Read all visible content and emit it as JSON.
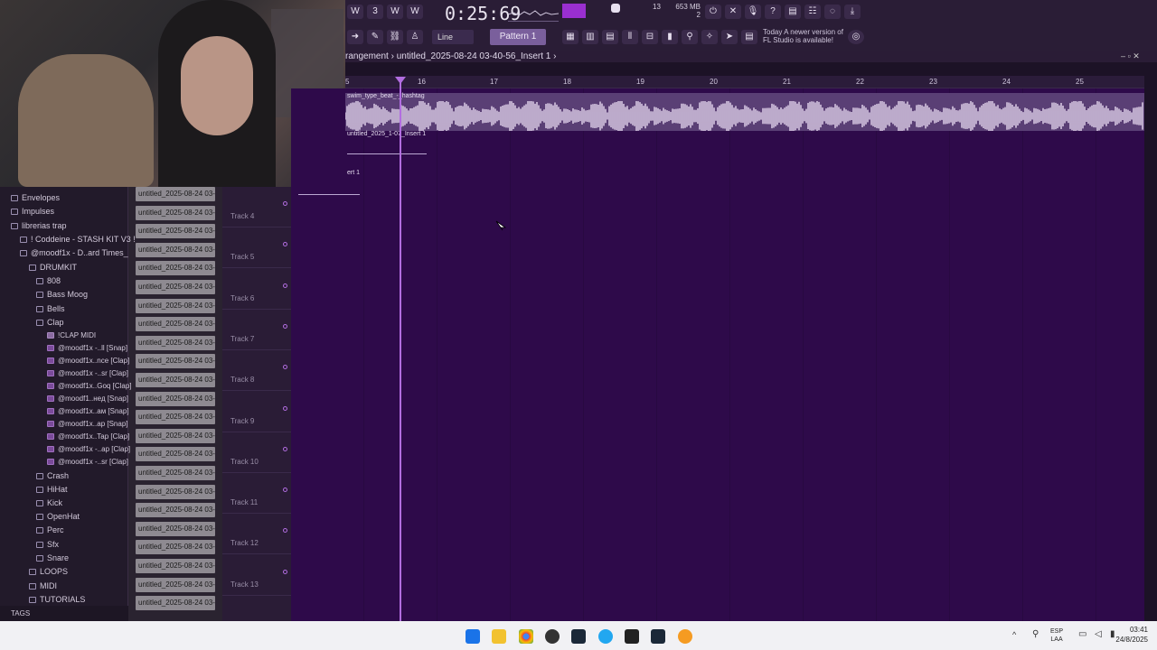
{
  "toolbar": {
    "time": "0:25:69",
    "cpu_count": "13",
    "memory": "653 MB",
    "voices": "2",
    "snap": "Line",
    "pattern": "Pattern 1",
    "news": "Today A newer version of FL Studio is available!"
  },
  "playlist": {
    "title": "rangement › untitled_2025-08-24 03-40-56_Insert 1 ›",
    "ruler": [
      "5",
      "16",
      "17",
      "18",
      "19",
      "20",
      "21",
      "22",
      "23",
      "24",
      "25"
    ],
    "audio_clip_label": "swim_type_beat_-_hashtag",
    "clip2_label": "untitled_2025_1-07_Insert 1",
    "clip3_label": "ert 1",
    "tracks": [
      "Track 4",
      "Track 5",
      "Track 6",
      "Track 7",
      "Track 8",
      "Track 9",
      "Track 10",
      "Track 11",
      "Track 12",
      "Track 13"
    ]
  },
  "channels": [
    "untitled_2025-08-24 03-...",
    "untitled_2025-08-24 03-...",
    "untitled_2025-08-24 03-...",
    "untitled_2025-08-24 03-...",
    "untitled_2025-08-24 03-...",
    "untitled_2025-08-24 03-...",
    "untitled_2025-08-24 03-...",
    "untitled_2025-08-24 03-...",
    "untitled_2025-08-24 03-...",
    "untitled_2025-08-24 03-...",
    "untitled_2025-08-24 03-...",
    "untitled_2025-08-24 03-...",
    "untitled_2025-08-24 03-...",
    "untitled_2025-08-24 03-...",
    "untitled_2025-08-24 03-...",
    "untitled_2025-08-24 03-...",
    "untitled_2025-08-24 03-...",
    "untitled_2025-08-24 03-...",
    "untitled_2025-08-24 03-...",
    "untitled_2025-08-24 03-...",
    "untitled_2025-08-24 03-...",
    "untitled_2025-08-24 03-...",
    "untitled_2025-08-24 03-..."
  ],
  "browser": {
    "items": [
      {
        "label": "Envelopes",
        "type": "folder"
      },
      {
        "label": "Impulses",
        "type": "folder"
      },
      {
        "label": "librerias trap",
        "type": "folder"
      },
      {
        "label": "! Coddeine - STASH KIT V3 !",
        "type": "folder"
      },
      {
        "label": "@moodf1x - D..ard Times_",
        "type": "folder"
      },
      {
        "label": "DRUMKIT",
        "type": "folder"
      },
      {
        "label": "808",
        "type": "folder"
      },
      {
        "label": "Bass Moog",
        "type": "folder"
      },
      {
        "label": "Bells",
        "type": "folder"
      },
      {
        "label": "Clap",
        "type": "folder"
      },
      {
        "label": "!CLAP MIDI",
        "type": "midi"
      },
      {
        "label": "@moodf1x -..ll [Snap]",
        "type": "file"
      },
      {
        "label": "@moodf1x..nce [Clap]",
        "type": "file"
      },
      {
        "label": "@moodf1x -..sr [Clap]",
        "type": "file"
      },
      {
        "label": "@moodf1x..Goq [Clap]",
        "type": "file"
      },
      {
        "label": "@moodf1..нед [Snap]",
        "type": "file"
      },
      {
        "label": "@moodf1x..ам [Snap]",
        "type": "file"
      },
      {
        "label": "@moodf1x..ap [Snap]",
        "type": "file"
      },
      {
        "label": "@moodf1x..Tap [Clap]",
        "type": "file"
      },
      {
        "label": "@moodf1x -..ap [Clap]",
        "type": "file"
      },
      {
        "label": "@moodf1x -..sr [Clap]",
        "type": "file"
      },
      {
        "label": "Crash",
        "type": "folder"
      },
      {
        "label": "HiHat",
        "type": "folder"
      },
      {
        "label": "Kick",
        "type": "folder"
      },
      {
        "label": "OpenHat",
        "type": "folder"
      },
      {
        "label": "Perc",
        "type": "folder"
      },
      {
        "label": "Sfx",
        "type": "folder"
      },
      {
        "label": "Snare",
        "type": "folder"
      },
      {
        "label": "LOOPS",
        "type": "folder"
      },
      {
        "label": "MIDI",
        "type": "folder"
      },
      {
        "label": "TUTORIALS",
        "type": "folder"
      }
    ],
    "tags_label": "TAGS"
  },
  "taskbar": {
    "lang_top": "ESP",
    "lang_bottom": "LAA",
    "time": "03:41",
    "date": "24/8/2025"
  },
  "colors": {
    "playlist_bg": "#2e0a4a",
    "accent": "#b26de0"
  }
}
